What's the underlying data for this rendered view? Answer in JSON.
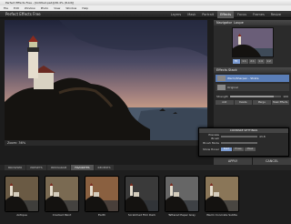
{
  "window": {
    "title": "Perfect Effects Free - [Untitled.psd@36.4% (8-bit)]"
  },
  "menubar": [
    "File",
    "Edit",
    "Window",
    "Photo",
    "View",
    "Window",
    "Help"
  ],
  "appbar": {
    "title": "Perfect Effects Free",
    "modes": [
      {
        "label": "Layers",
        "active": false
      },
      {
        "label": "Mask",
        "active": false
      },
      {
        "label": "Portrait",
        "active": false
      },
      {
        "label": "Effects",
        "active": true
      },
      {
        "label": "Focus",
        "active": false
      },
      {
        "label": "Frames",
        "active": false
      },
      {
        "label": "Resize",
        "active": false
      }
    ]
  },
  "canvas": {
    "zoom_label": "Zoom: 36%"
  },
  "navigator": {
    "title": "Navigator",
    "subtitle": "Loupe",
    "zoom_buttons": [
      {
        "label": "Fit",
        "active": true
      },
      {
        "label": "1:1",
        "active": false
      },
      {
        "label": "2:1",
        "active": false
      },
      {
        "label": "1:4",
        "active": false
      },
      {
        "label": "1:2",
        "active": false
      }
    ]
  },
  "effects_stack": {
    "title": "Effects Stack",
    "layers": [
      {
        "label": "Warm/Sharpen - Strata",
        "selected": true
      },
      {
        "label": "Original",
        "selected": false
      }
    ],
    "strength_label": "Strength",
    "strength_value": "100",
    "strength_fraction": 0.85,
    "buttons": [
      "Add",
      "Delete",
      "Merge",
      "Mask Effects"
    ]
  },
  "dialog": {
    "title": "COMPARE SETTINGS",
    "rows": [
      {
        "label": "Preview Brush",
        "value": "43.8"
      },
      {
        "label": "Brush Mode",
        "value": ""
      }
    ],
    "hover_label": "Show Hover",
    "hover_options": [
      {
        "label": "Paint",
        "active": true
      },
      {
        "label": "Erase",
        "active": false
      },
      {
        "label": "Mask",
        "active": false
      }
    ]
  },
  "bottom_buttons": {
    "apply": "APPLY",
    "cancel": "CANCEL"
  },
  "browser": {
    "tabs": [
      {
        "label": "BROWSER",
        "active": false
      },
      {
        "label": "PRESETS",
        "active": false
      },
      {
        "label": "INSTAGRAM",
        "active": false
      },
      {
        "label": "FAVORITES",
        "active": true
      },
      {
        "label": "RECENTS",
        "active": false
      }
    ],
    "tiles": [
      "Antique",
      "Cracked Paint",
      "Earth",
      "Scratched Film Dark",
      "Tattered Paper Gray",
      "Warm Concrete Subtle"
    ]
  }
}
